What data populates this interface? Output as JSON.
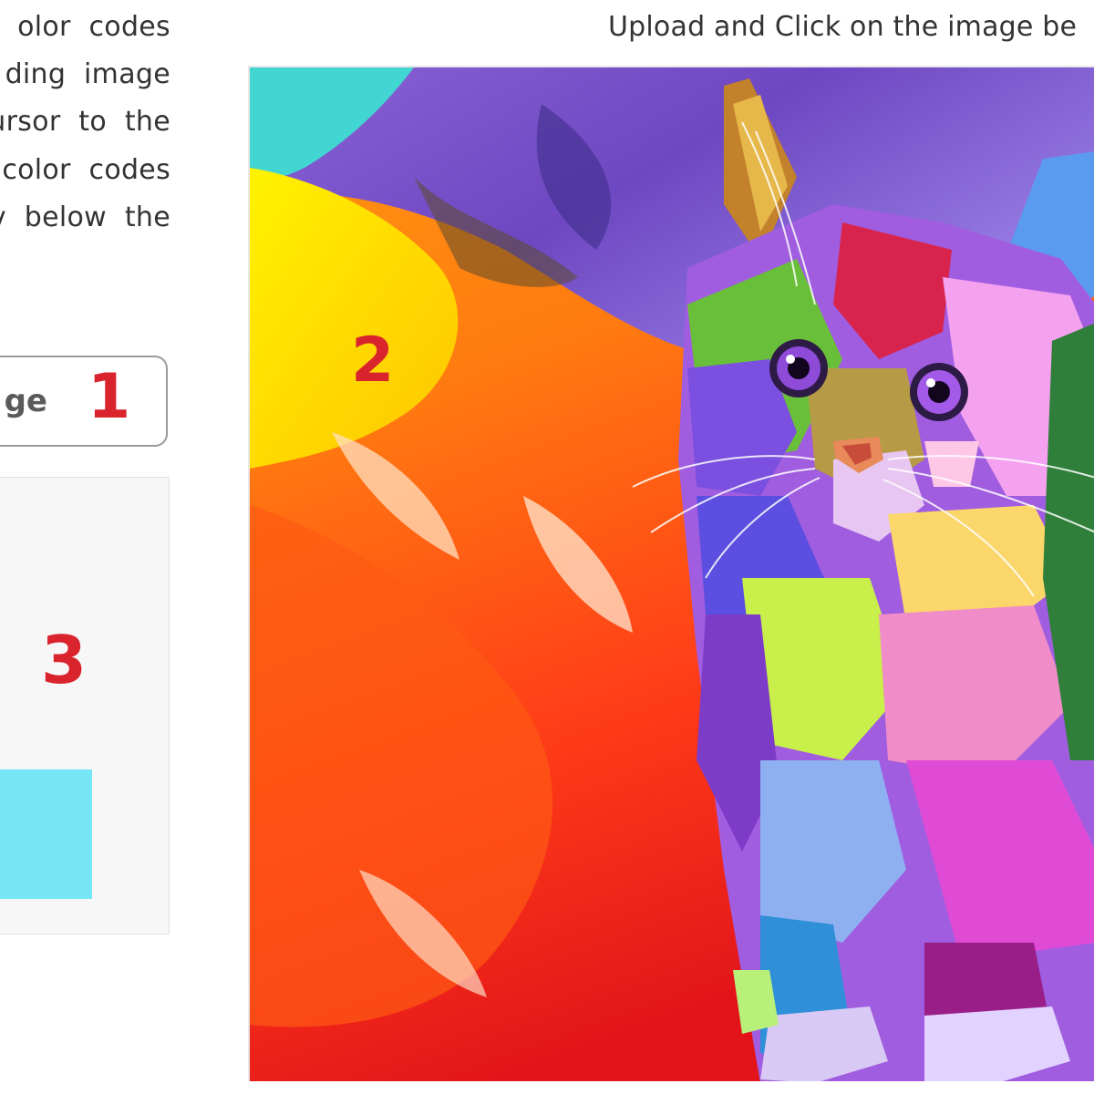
{
  "instructions": {
    "description_lines": [
      "olor  codes",
      "ding  image",
      "ursor  to  the",
      "color codes",
      "v  below  the"
    ],
    "top": "Upload and Click on the image be"
  },
  "upload_button": {
    "label": "ge"
  },
  "markers": {
    "one": "1",
    "two": "2",
    "three": "3"
  },
  "selected_color": {
    "swatch_hex": "#76e6f7"
  },
  "uploaded_image": {
    "subject": "colorful pop-art kitten on paint background"
  },
  "colors": {
    "marker": "#d9232d",
    "text": "#333333",
    "button_border": "#9a9a9a",
    "panel_background": "#f7f7f7"
  }
}
